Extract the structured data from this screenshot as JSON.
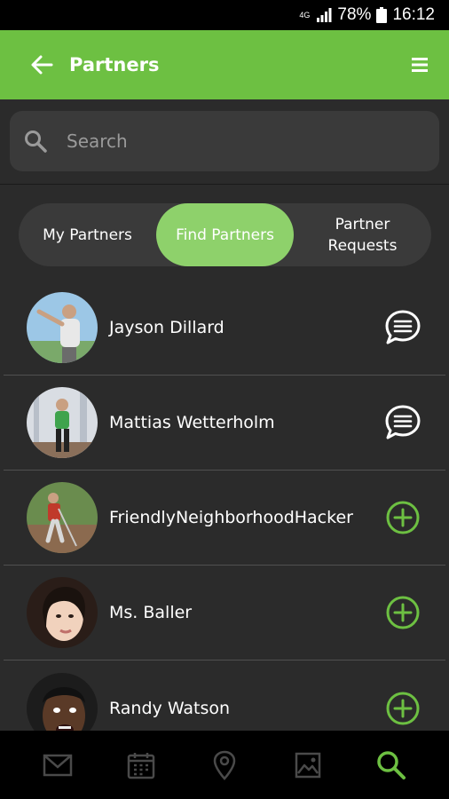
{
  "status_bar": {
    "network": "4G",
    "battery": "78%",
    "time": "16:12"
  },
  "app_bar": {
    "title": "Partners"
  },
  "search": {
    "placeholder": "Search"
  },
  "tabs": [
    {
      "label": "My Partners",
      "active": false
    },
    {
      "label": "Find Partners",
      "active": true
    },
    {
      "label": "Partner\nRequests",
      "active": false
    }
  ],
  "partners": [
    {
      "name": "Jayson Dillard",
      "action": "message-icon"
    },
    {
      "name": "Mattias Wetterholm",
      "action": "message-icon"
    },
    {
      "name": "FriendlyNeighborhoodHacker",
      "action": "add-icon"
    },
    {
      "name": "Ms. Baller",
      "action": "add-icon"
    },
    {
      "name": "Randy Watson",
      "action": "add-icon"
    }
  ],
  "bottom_nav": [
    {
      "icon": "mail-icon",
      "active": false
    },
    {
      "icon": "calendar-icon",
      "active": false
    },
    {
      "icon": "location-pin-icon",
      "active": false
    },
    {
      "icon": "gallery-icon",
      "active": false
    },
    {
      "icon": "search-icon",
      "active": true
    }
  ],
  "colors": {
    "accent": "#6dc042",
    "tab_active": "#8ed16b",
    "background": "#2b2b2b",
    "icon_inactive": "#4a4a4a"
  }
}
